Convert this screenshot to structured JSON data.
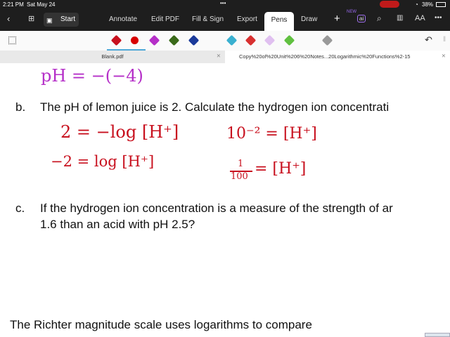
{
  "status": {
    "time": "2:21 PM",
    "date": "Sat May 24",
    "battery": "38%"
  },
  "toolbar": {
    "start": "Start",
    "tabs": [
      "Annotate",
      "Edit PDF",
      "Fill & Sign",
      "Export",
      "Pens",
      "Draw"
    ],
    "new_badge": "NEW",
    "ai": "ai",
    "font_size": "AA"
  },
  "pens": {
    "colors": [
      "#c8101e",
      "#d80000",
      "#b52fc8",
      "#3a6a1a",
      "#1a3a9a",
      "#3ab0d0",
      "#d83030",
      "#e0c0f0",
      "#60c040",
      "#888888"
    ]
  },
  "doc_tabs": [
    {
      "label": "Blank.pdf"
    },
    {
      "label": "Copy%20of%20Unit%206%20Notes...20Logarithmic%20Functions%2-15"
    }
  ],
  "document": {
    "hw_top": "pH = −(−4)",
    "b_label": "b.",
    "b_text": "The pH of lemon juice is 2.  Calculate the hydrogen ion concentrati",
    "hw_b1": "2 = −log [H⁺]",
    "hw_b2": "−2 = log [H⁺]",
    "hw_b3": "10⁻² = [H⁺]",
    "hw_b4_num": "1",
    "hw_b4_den": "100",
    "hw_b4_rest": "= [H⁺]",
    "c_label": "c.",
    "c_text1": "If the hydrogen ion concentration is a measure of the strength of ar",
    "c_text2": "1.6 than an acid with pH 2.5?",
    "richter": "The Richter magnitude scale uses logarithms to compare"
  }
}
